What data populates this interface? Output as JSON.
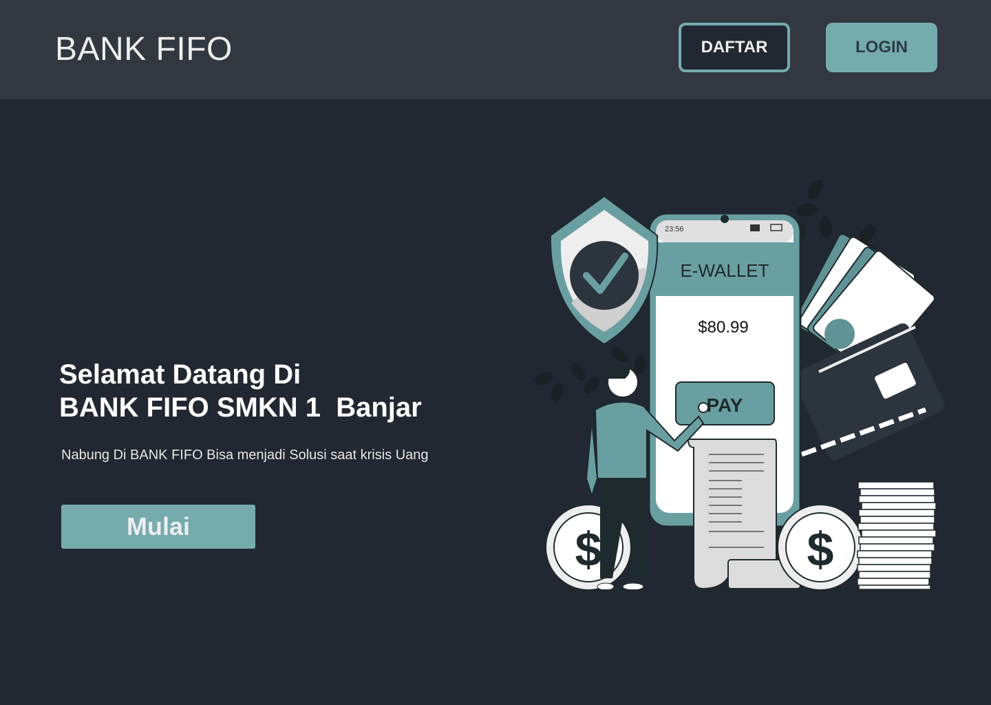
{
  "header": {
    "brand": "BANK FIFO",
    "daftar_label": "DAFTAR",
    "login_label": "LOGIN"
  },
  "hero": {
    "title_line1": "Selamat Datang Di",
    "title_line2": "BANK FIFO SMKN 1  Banjar",
    "subtitle": "Nabung Di BANK FIFO Bisa menjadi Solusi saat krisis Uang",
    "cta_label": "Mulai"
  },
  "illustration": {
    "phone_time": "23:56",
    "wallet_title": "E-WALLET",
    "amount": "$80.99",
    "pay_label": "PAY",
    "coin_symbol": "$"
  },
  "colors": {
    "background": "#222831",
    "header": "#333740",
    "accent": "#76abae",
    "text": "#eeeeee"
  }
}
